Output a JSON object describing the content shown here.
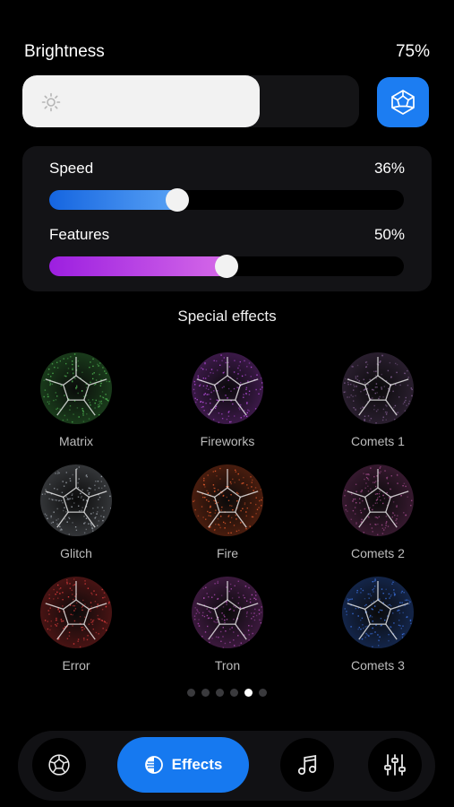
{
  "brightness": {
    "label": "Brightness",
    "value_text": "75%",
    "level": 0.75
  },
  "speed": {
    "label": "Speed",
    "value_text": "36%",
    "level": 0.36
  },
  "features": {
    "label": "Features",
    "value_text": "50%",
    "level": 0.5
  },
  "section_title": "Special effects",
  "effects": [
    {
      "label": "Matrix",
      "color": "#4caf50"
    },
    {
      "label": "Fireworks",
      "color": "#b04bd6"
    },
    {
      "label": "Comets 1",
      "color": "#7b5a8a"
    },
    {
      "label": "Glitch",
      "color": "#9aa0a8"
    },
    {
      "label": "Fire",
      "color": "#d9562a"
    },
    {
      "label": "Comets 2",
      "color": "#a04a8a"
    },
    {
      "label": "Error",
      "color": "#d63a3a"
    },
    {
      "label": "Tron",
      "color": "#b04bb5"
    },
    {
      "label": "Comets 3",
      "color": "#3a6ed9"
    }
  ],
  "pagination": {
    "pages": 6,
    "active": 4
  },
  "tabbar": {
    "active_label": "Effects",
    "icons": [
      "cube-icon",
      "effects-icon",
      "music-icon",
      "sliders-icon"
    ]
  },
  "colors": {
    "accent": "#1679f0",
    "speed_gradient": [
      "#1565e0",
      "#5aa3f5"
    ],
    "features_gradient": [
      "#9c1fe0",
      "#d66ae8"
    ]
  }
}
